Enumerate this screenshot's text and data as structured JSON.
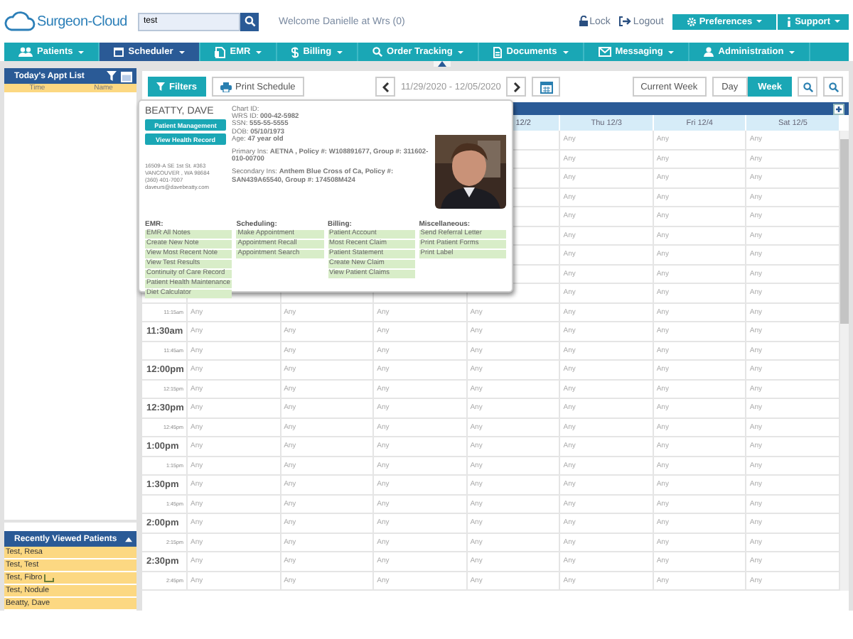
{
  "header": {
    "logo": "Surgeon-Cloud",
    "search": {
      "value": "test"
    },
    "welcome": "Welcome Danielle at Wrs (0)",
    "lock": "Lock",
    "logout": "Logout",
    "menus": [
      {
        "label": "Preferences"
      },
      {
        "label": "Support"
      }
    ]
  },
  "nav": [
    {
      "label": "Patients",
      "selected": false
    },
    {
      "label": "Scheduler",
      "selected": true
    },
    {
      "label": "EMR",
      "selected": false
    },
    {
      "label": "Billing",
      "selected": false
    },
    {
      "label": "Order Tracking",
      "selected": false
    },
    {
      "label": "Documents",
      "selected": false
    },
    {
      "label": "Messaging",
      "selected": false
    },
    {
      "label": "Administration",
      "selected": false
    }
  ],
  "sidebar": {
    "appt_title": "Today's Appt List",
    "columns": [
      "Time",
      "Name"
    ],
    "recent_title": "Recently Viewed Patients",
    "recent": [
      {
        "name": "Test, Resa",
        "note": false
      },
      {
        "name": "Test, Test",
        "note": false
      },
      {
        "name": "Test, Fibro",
        "note": true
      },
      {
        "name": "Test, Nodule",
        "note": false
      },
      {
        "name": "Beatty, Dave",
        "note": false
      }
    ]
  },
  "toolbar": {
    "filters": "Filters",
    "print": "Print Schedule",
    "range": "11/29/2020 - 12/05/2020",
    "current": "Current Week",
    "views": [
      {
        "label": "Day",
        "selected": false
      },
      {
        "label": "Week",
        "selected": true
      }
    ]
  },
  "calendar": {
    "days": [
      "12/2",
      "Thu 12/3",
      "Fri 12/4",
      "Sat 12/5"
    ],
    "rows": [
      {
        "cells": [
          "Any",
          "Any",
          "Any"
        ]
      },
      {
        "cells": [
          "Any",
          "Any",
          "Any"
        ]
      },
      {
        "cells": [
          "Any",
          "Any",
          "Any"
        ]
      },
      {
        "cells": [
          "Any",
          "Any",
          "Any"
        ]
      },
      {
        "cells": [
          "Any",
          "Any",
          "Any"
        ]
      },
      {
        "cells": [
          "Any",
          "Any",
          "Any"
        ]
      },
      {
        "cells": [
          "Any",
          "Any",
          "Any"
        ]
      },
      {
        "cells": [
          "Any",
          "Any",
          "Any"
        ]
      },
      {
        "cells": [
          "Any",
          "Any",
          "Any"
        ]
      },
      {
        "time": "11:15am",
        "major": false,
        "cells": [
          "Any",
          "Any",
          "Any",
          "Any",
          "Any",
          "Any",
          "Any"
        ]
      },
      {
        "time": "11:30am",
        "major": true,
        "cells": [
          "Any",
          "Any",
          "Any",
          "Any",
          "Any",
          "Any",
          "Any"
        ]
      },
      {
        "time": "11:45am",
        "major": false,
        "cells": [
          "Any",
          "Any",
          "Any",
          "Any",
          "Any",
          "Any",
          "Any"
        ]
      },
      {
        "time": "12:00pm",
        "major": true,
        "cells": [
          "Any",
          "Any",
          "Any",
          "Any",
          "Any",
          "Any",
          "Any"
        ]
      },
      {
        "time": "12:15pm",
        "major": false,
        "cells": [
          "Any",
          "Any",
          "Any",
          "Any",
          "Any",
          "Any",
          "Any"
        ]
      },
      {
        "time": "12:30pm",
        "major": true,
        "cells": [
          "Any",
          "Any",
          "Any",
          "Any",
          "Any",
          "Any",
          "Any"
        ]
      },
      {
        "time": "12:45pm",
        "major": false,
        "cells": [
          "Any",
          "Any",
          "Any",
          "Any",
          "Any",
          "Any",
          "Any"
        ]
      },
      {
        "time": "1:00pm",
        "major": true,
        "cells": [
          "Any",
          "Any",
          "Any",
          "Any",
          "Any",
          "Any",
          "Any"
        ]
      },
      {
        "time": "1:15pm",
        "major": false,
        "cells": [
          "Any",
          "Any",
          "Any",
          "Any",
          "Any",
          "Any",
          "Any"
        ]
      },
      {
        "time": "1:30pm",
        "major": true,
        "cells": [
          "Any",
          "Any",
          "Any",
          "Any",
          "Any",
          "Any",
          "Any"
        ]
      },
      {
        "time": "1:45pm",
        "major": false,
        "cells": [
          "Any",
          "Any",
          "Any",
          "Any",
          "Any",
          "Any",
          "Any"
        ]
      },
      {
        "time": "2:00pm",
        "major": true,
        "cells": [
          "Any",
          "Any",
          "Any",
          "Any",
          "Any",
          "Any",
          "Any"
        ]
      },
      {
        "time": "2:15pm",
        "major": false,
        "cells": [
          "Any",
          "Any",
          "Any",
          "Any",
          "Any",
          "Any",
          "Any"
        ]
      },
      {
        "time": "2:30pm",
        "major": true,
        "cells": [
          "Any",
          "Any",
          "Any",
          "Any",
          "Any",
          "Any",
          "Any"
        ]
      },
      {
        "time": "2:45pm",
        "major": false,
        "cells": [
          "Any",
          "Any",
          "Any",
          "Any",
          "Any",
          "Any",
          "Any"
        ]
      }
    ]
  },
  "popup": {
    "name": "BEATTY, DAVE",
    "buttons": [
      "Patient Management",
      "View Health Record"
    ],
    "address": [
      "16509-A SE 1st St. #363",
      "VANCOUVER , WA 98684",
      "(360) 401-7007",
      "daveurs@davebeatty.com"
    ],
    "info": [
      "Chart ID:",
      "WRS ID: **000-42-5982**",
      "SSN: **555-55-5555**",
      "DOB: **05/10/1973**",
      "Age: **47 year old**"
    ],
    "insurance": [
      "Primary Ins: **AETNA , Policy #: W108891677, Group #: 311602-010-00700**",
      "Secondary Ins: **Anthem Blue Cross of Ca, Policy #: SAN439A65540, Group #: 174508M424**"
    ],
    "photo": {
      "kind": "picture"
    },
    "groups": [
      {
        "title": "EMR:",
        "links": [
          "EMR All Notes",
          "Create New Note",
          "View Most Recent Note",
          "View Test Results",
          "Continuity of Care Record",
          "Patient Health Maintenance",
          "Diet Calculator"
        ]
      },
      {
        "title": "Scheduling:",
        "links": [
          "Make Appointment",
          "Appointment Recall",
          "Appointment Search"
        ]
      },
      {
        "title": "Billing:",
        "links": [
          "Patient Account",
          "Most Recent Claim",
          "Patient Statement",
          "Create New Claim",
          "View Patient Claims"
        ]
      },
      {
        "title": "Miscellaneous:",
        "links": [
          "Send Referral Letter",
          "Print Patient Forms",
          "Print Label"
        ]
      }
    ]
  }
}
